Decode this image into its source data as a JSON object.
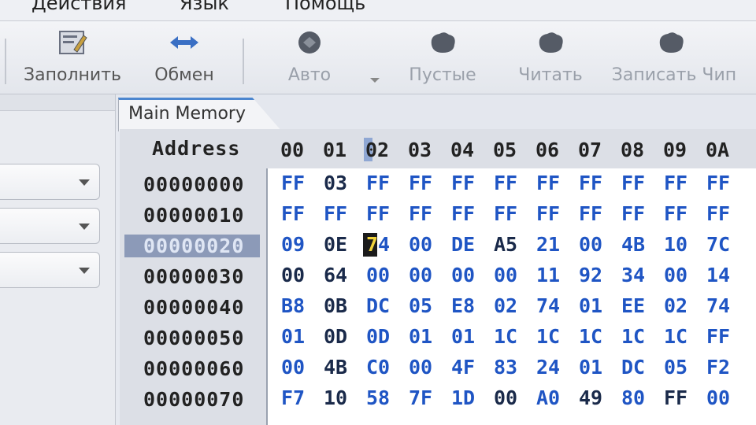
{
  "menu": [
    "Действия",
    "Язык",
    "Помощь"
  ],
  "toolbar": {
    "buttons": [
      {
        "label": "Заполнить",
        "icon": "fill-icon",
        "enabled": true
      },
      {
        "label": "Обмен",
        "icon": "swap-arrows-icon",
        "enabled": true
      },
      {
        "label": "Авто",
        "icon": "chip-auto-icon",
        "enabled": false
      },
      {
        "label": "Пустые",
        "icon": "chip-blank-icon",
        "enabled": false
      },
      {
        "label": "Читать",
        "icon": "chip-read-icon",
        "enabled": false
      },
      {
        "label": "Записать Чип",
        "icon": "chip-write-icon",
        "enabled": false
      }
    ]
  },
  "tab": {
    "label": "Main Memory"
  },
  "hex": {
    "address_header": "Address",
    "columns": [
      "00",
      "01",
      "02",
      "03",
      "04",
      "05",
      "06",
      "07",
      "08",
      "09",
      "0A"
    ],
    "selected_row": 2,
    "cursor_column": 2,
    "rows": [
      {
        "address": "00000000",
        "cells": [
          "FF",
          "03",
          "FF",
          "FF",
          "FF",
          "FF",
          "FF",
          "FF",
          "FF",
          "FF",
          "FF"
        ]
      },
      {
        "address": "00000010",
        "cells": [
          "FF",
          "FF",
          "FF",
          "FF",
          "FF",
          "FF",
          "FF",
          "FF",
          "FF",
          "FF",
          "FF"
        ]
      },
      {
        "address": "00000020",
        "cells": [
          "09",
          "0E",
          "74",
          "00",
          "DE",
          "A5",
          "21",
          "00",
          "4B",
          "10",
          "7C"
        ]
      },
      {
        "address": "00000030",
        "cells": [
          "00",
          "64",
          "00",
          "00",
          "00",
          "00",
          "11",
          "92",
          "34",
          "00",
          "14"
        ]
      },
      {
        "address": "00000040",
        "cells": [
          "B8",
          "0B",
          "DC",
          "05",
          "E8",
          "02",
          "74",
          "01",
          "EE",
          "02",
          "74"
        ]
      },
      {
        "address": "00000050",
        "cells": [
          "01",
          "0D",
          "0D",
          "01",
          "01",
          "1C",
          "1C",
          "1C",
          "1C",
          "1C",
          "FF"
        ]
      },
      {
        "address": "00000060",
        "cells": [
          "00",
          "4B",
          "C0",
          "00",
          "4F",
          "83",
          "24",
          "01",
          "DC",
          "05",
          "F2"
        ]
      },
      {
        "address": "00000070",
        "cells": [
          "F7",
          "10",
          "58",
          "7F",
          "1D",
          "00",
          "A0",
          "49",
          "80",
          "FF",
          "00"
        ]
      }
    ]
  },
  "colors": {
    "byte_blue": "#1f55c4",
    "byte_dark": "#1a2a4a",
    "selection": "#8c9ab8",
    "tab_accent": "#4c86cf"
  }
}
